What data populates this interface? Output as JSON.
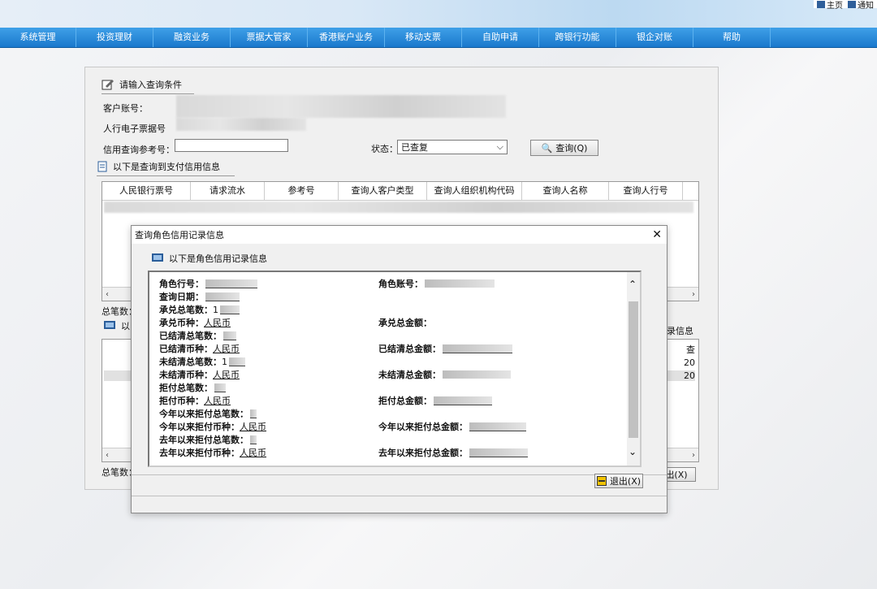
{
  "top_links": [
    {
      "label": "主页"
    },
    {
      "label": "通知"
    }
  ],
  "nav": [
    "系统管理",
    "投资理财",
    "融资业务",
    "票据大管家",
    "香港账户业务",
    "移动支票",
    "自助申请",
    "跨银行功能",
    "银企对账",
    "帮助"
  ],
  "query": {
    "title": "请输入查询条件",
    "customer_account_label": "客户账号：",
    "bill_number_label": "人行电子票据号",
    "credit_ref_label": "信用查询参考号：",
    "credit_ref_value": "",
    "status_label": "状态：",
    "status_value": "已查复",
    "query_button": "查询(Q)"
  },
  "results": {
    "title": "以下是查询到支付信用信息",
    "columns": [
      "人民银行票号",
      "请求流水",
      "参考号",
      "查询人客户类型",
      "查询人组织机构代码",
      "查询人名称",
      "查询人行号"
    ],
    "total_label": "总笔数：",
    "total_label2": "总笔数：",
    "lower_title_fragment": "以",
    "right_fragment": "录信息",
    "right_col_fragment": "查",
    "row_values": [
      "20",
      "20"
    ],
    "exit_fragment": "出(X)"
  },
  "dialog": {
    "title": "查询角色信用记录信息",
    "section_title": "以下是角色信用记录信息",
    "fields_left": [
      {
        "label": "角色行号：",
        "value": ""
      },
      {
        "label": "查询日期：",
        "value": ""
      },
      {
        "label": "承兑总笔数：",
        "value": "1"
      },
      {
        "label": "承兑币种：",
        "value": "人民币"
      },
      {
        "label": "已结清总笔数：",
        "value": ""
      },
      {
        "label": "已结清币种：",
        "value": "人民币"
      },
      {
        "label": "未结清总笔数：",
        "value": "1"
      },
      {
        "label": "未结清币种：",
        "value": "人民币"
      },
      {
        "label": "拒付总笔数：",
        "value": ""
      },
      {
        "label": "拒付币种：",
        "value": "人民币"
      },
      {
        "label": "今年以来拒付总笔数：",
        "value": ""
      },
      {
        "label": "今年以来拒付币种：",
        "value": "人民币"
      },
      {
        "label": "去年以来拒付总笔数：",
        "value": ""
      },
      {
        "label": "去年以来拒付币种：",
        "value": "人民币"
      }
    ],
    "fields_right": [
      {
        "label": "角色账号："
      },
      {
        "label": "承兑总金额："
      },
      {
        "label": "已结清总金额："
      },
      {
        "label": "未结清总金额："
      },
      {
        "label": "拒付总金额："
      },
      {
        "label": "今年以来拒付总金额："
      },
      {
        "label": "去年以来拒付总金额："
      }
    ],
    "exit_button": "退出(X)"
  }
}
